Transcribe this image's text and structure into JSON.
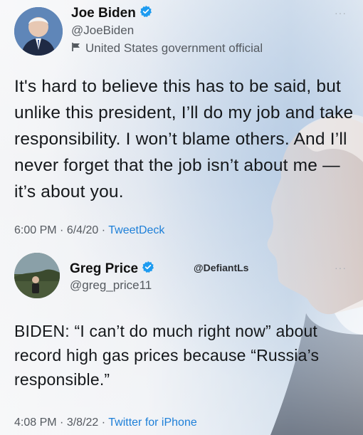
{
  "tweet1": {
    "name": "Joe Biden",
    "handle": "@JoeBiden",
    "label": "United States government official",
    "text": "It's hard to believe this has to be said, but unlike this president, I’ll do my job and take responsibility. I won’t blame others. And I’ll never forget that the job isn’t about me — it’s about you.",
    "time": "6:00 PM",
    "date": "6/4/20",
    "source": "TweetDeck",
    "verified_color": "#1d9bf0"
  },
  "tweet2": {
    "name": "Greg Price",
    "handle": "@greg_price11",
    "text": "BIDEN: “I can’t do much right now” about record high gas prices because “Russia’s responsible.”",
    "time": "4:08 PM",
    "date": "3/8/22",
    "source": "Twitter for iPhone",
    "verified_color": "#1d9bf0"
  },
  "watermark": "@DefiantLs",
  "sep": "·",
  "more": "···"
}
